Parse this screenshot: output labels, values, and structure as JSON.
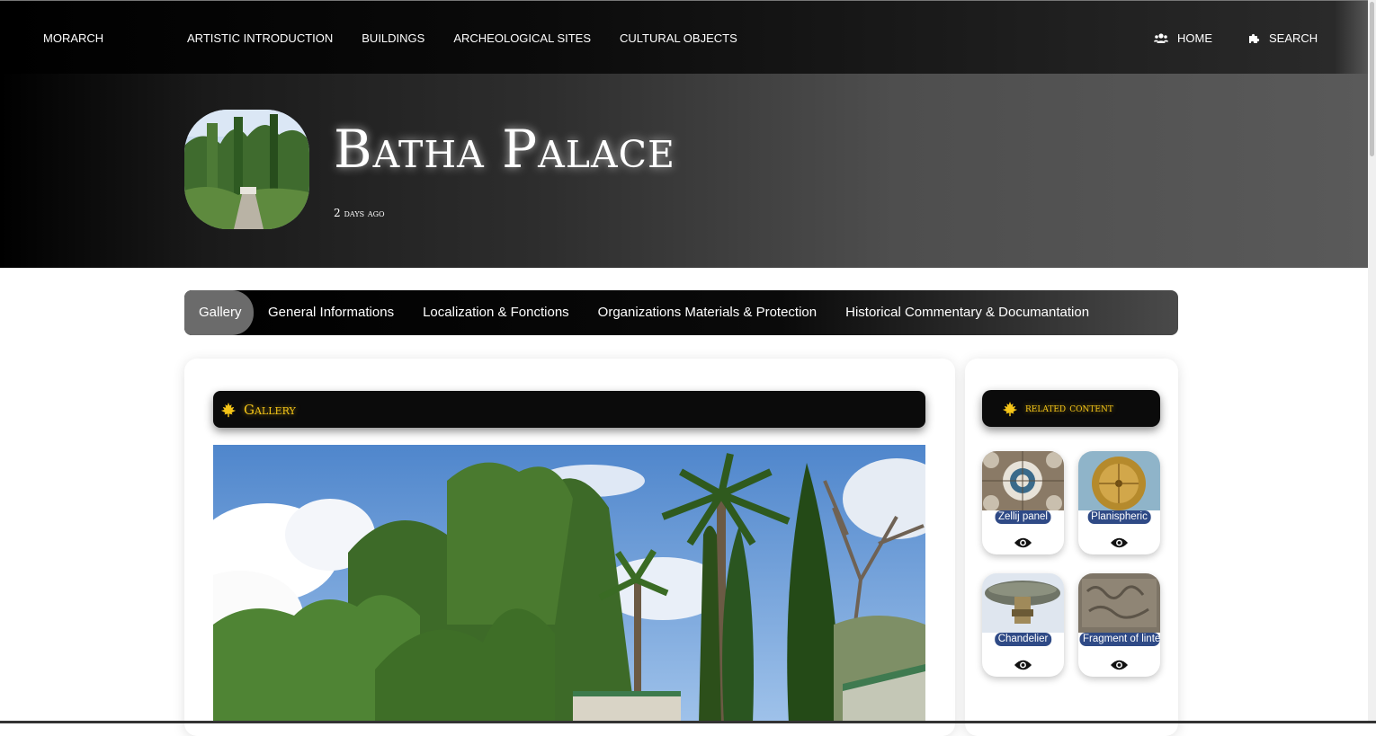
{
  "nav": {
    "brand": "MORARCH",
    "links": [
      "ARTISTIC INTRODUCTION",
      "BUILDINGS",
      "ARCHEOLOGICAL SITES",
      "CULTURAL OBJECTS"
    ],
    "home_label": "HOME",
    "search_label": "SEARCH"
  },
  "hero": {
    "title": "Batha Palace",
    "date": "2 days ago"
  },
  "tabs": [
    "Gallery",
    "General Informations",
    "Localization & Fonctions",
    "Organizations Materials & Protection",
    "Historical Commentary & Documantation"
  ],
  "gallery": {
    "heading": "Gallery"
  },
  "related": {
    "heading": "related content",
    "items": [
      {
        "label": "Zellij panel"
      },
      {
        "label": "Planispheric"
      },
      {
        "label": "Chandelier"
      },
      {
        "label": "Fragment of linte"
      }
    ]
  },
  "colors": {
    "accent_gold": "#f5c518",
    "label_blue": "#2f4a86"
  },
  "icons": {
    "home": "users-icon",
    "search": "puzzle-icon",
    "section": "maple-leaf-icon",
    "view": "eye-icon"
  }
}
